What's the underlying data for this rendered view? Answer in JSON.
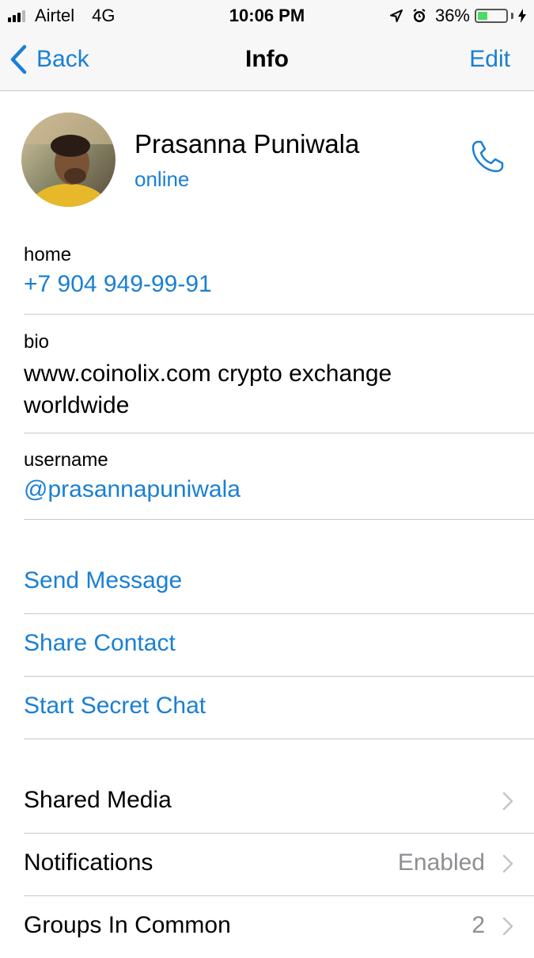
{
  "status_bar": {
    "carrier": "Airtel",
    "network": "4G",
    "time": "10:06 PM",
    "battery": "36%",
    "battery_level": 0.36,
    "icons": [
      "signal-icon",
      "location-arrow-icon",
      "alarm-icon",
      "battery-icon",
      "charging-bolt-icon"
    ]
  },
  "nav": {
    "back_label": "Back",
    "title": "Info",
    "edit_label": "Edit"
  },
  "profile": {
    "name": "Prasanna Puniwala",
    "status": "online",
    "avatar_icon": "avatar-photo",
    "call_icon": "phone-icon"
  },
  "fields": {
    "phone": {
      "label": "home",
      "value": "+7 904 949-99-91"
    },
    "bio": {
      "label": "bio",
      "line1": "www.coinolix.com crypto exchange",
      "line2": "worldwide"
    },
    "username": {
      "label": "username",
      "value": "@prasannapuniwala"
    }
  },
  "actions": {
    "send_message": "Send Message",
    "share_contact": "Share Contact",
    "start_secret_chat": "Start Secret Chat"
  },
  "rows": {
    "shared_media": {
      "label": "Shared Media"
    },
    "notifications": {
      "label": "Notifications",
      "value": "Enabled"
    },
    "groups_in_common": {
      "label": "Groups In Common",
      "value": "2"
    }
  },
  "colors": {
    "accent": "#1a7fd4",
    "separator": "#c8c8cc",
    "secondary_text": "#8e8e93",
    "bar_background": "#f7f7f7",
    "battery_fill": "#4cd964"
  }
}
